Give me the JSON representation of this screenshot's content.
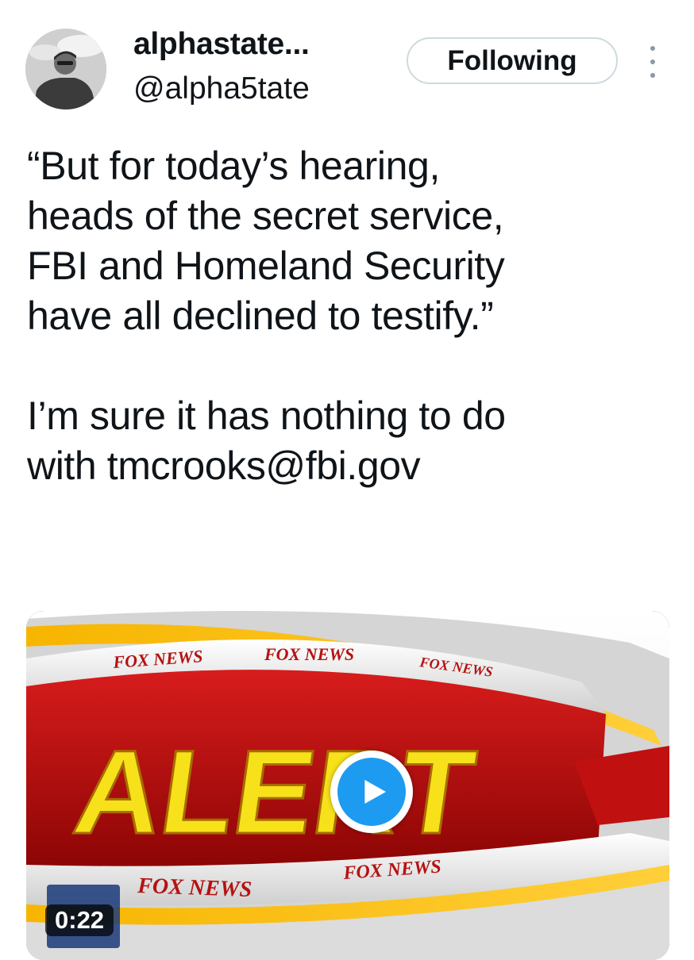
{
  "author": {
    "display_name": "alphastate...",
    "handle": "@alpha5tate",
    "avatar_icon": "profile-photo"
  },
  "follow_button": {
    "label": "Following"
  },
  "more_menu": {
    "icon": "more-vertical-icon"
  },
  "tweet": {
    "paragraphs": [
      "“But for today’s hearing,\nheads of the secret service,\nFBI and Homeland Security\nhave all declined to testify.”",
      "I’m sure it has nothing to do\nwith tmcrooks@fbi.gov"
    ]
  },
  "media": {
    "type": "video",
    "duration": "0:22",
    "headline_word": "ALERT",
    "brand_text": "FOX NEWS",
    "play_icon": "play-icon",
    "colors": {
      "play_button": "#1d9bf0",
      "headline": "#f7e11a",
      "backdrop": "#b10f0f"
    }
  }
}
